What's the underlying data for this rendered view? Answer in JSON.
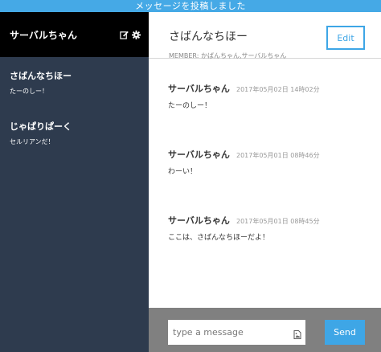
{
  "toast": {
    "message": "メッセージを投稿しました"
  },
  "sidebar": {
    "user_name": "サーバルちゃん",
    "icons": [
      "edit-icon",
      "gear-icon"
    ],
    "rooms": [
      {
        "name": "さばんなちほー",
        "last_message": "たーのしー！"
      },
      {
        "name": "じゃぱりぱーく",
        "last_message": "セルリアンだ！"
      }
    ]
  },
  "room": {
    "title": "さばんなちほー",
    "members": "MEMBER: かばんちゃん,サーバルちゃん",
    "edit_label": "Edit"
  },
  "messages": [
    {
      "author": "サーバルちゃん",
      "time": "2017年05月02日 14時02分",
      "text": "たーのしー！"
    },
    {
      "author": "サーバルちゃん",
      "time": "2017年05月01日 08時46分",
      "text": "わーい！"
    },
    {
      "author": "サーバルちゃん",
      "time": "2017年05月01日 08時45分",
      "text": "ここは、さばんなちほーだよ！"
    }
  ],
  "composer": {
    "placeholder": "type a message",
    "value": "",
    "send_label": "Send",
    "icon": "image-icon"
  },
  "colors": {
    "accent": "#3ea6e6",
    "toast": "#45a9e6",
    "sidebar": "#2e3b4e",
    "sidebar_header": "#000000",
    "composer_bg": "#808080"
  }
}
